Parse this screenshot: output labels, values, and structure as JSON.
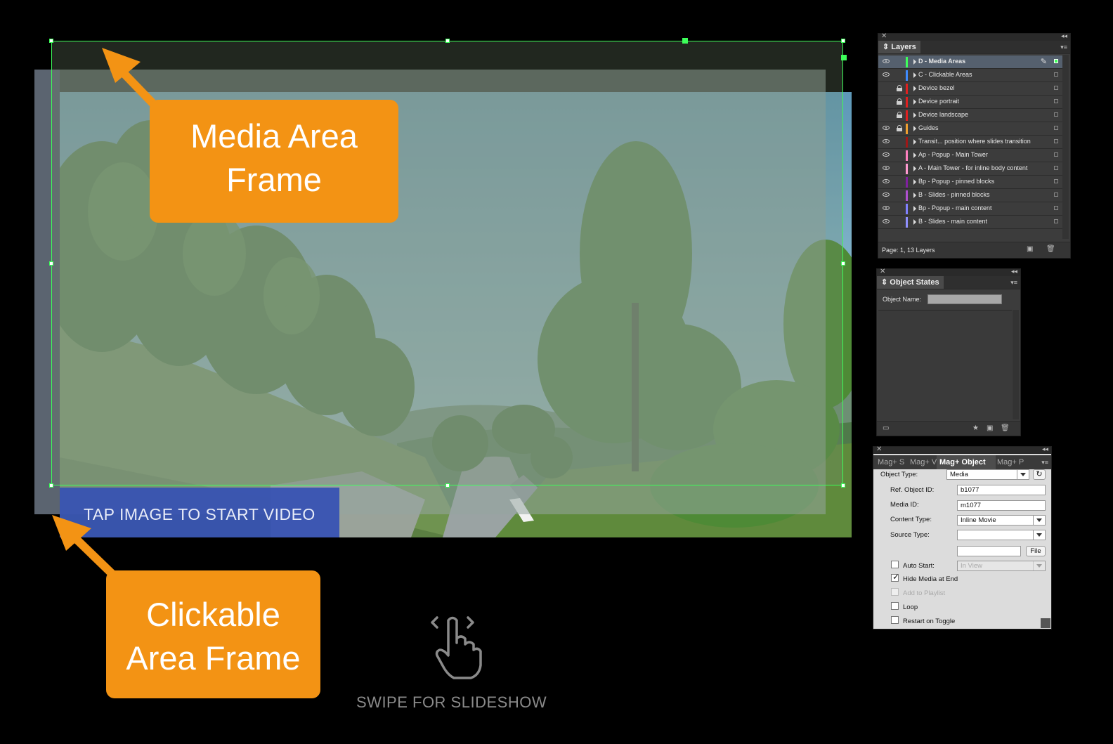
{
  "overlay": {
    "tap_text": "TAP IMAGE TO START VIDEO",
    "swipe_text": "SWIPE FOR SLIDESHOW"
  },
  "callouts": {
    "media_area": [
      "Media Area",
      "Frame"
    ],
    "clickable_area": [
      "Clickable",
      "Area Frame"
    ],
    "color": "#f39314"
  },
  "layers_panel": {
    "title": "Layers",
    "footer": "Page: 1, 13 Layers",
    "layers": [
      {
        "name": "D - Media Areas",
        "color": "#3dff5a",
        "visible": true,
        "locked": false,
        "selected": true
      },
      {
        "name": "C - Clickable Areas",
        "color": "#3f8cff",
        "visible": true,
        "locked": false,
        "selected": false
      },
      {
        "name": "Device bezel",
        "color": "#e02020",
        "visible": false,
        "locked": true,
        "selected": false
      },
      {
        "name": "Device portrait",
        "color": "#e02020",
        "visible": false,
        "locked": true,
        "selected": false
      },
      {
        "name": "Device landscape",
        "color": "#e02020",
        "visible": false,
        "locked": true,
        "selected": false
      },
      {
        "name": "Guides",
        "color": "#f0a030",
        "visible": true,
        "locked": true,
        "selected": false
      },
      {
        "name": "Transit... position where slides transition",
        "color": "#a01818",
        "visible": true,
        "locked": false,
        "selected": false
      },
      {
        "name": "Ap - Popup - Main Tower",
        "color": "#ff80c0",
        "visible": true,
        "locked": false,
        "selected": false
      },
      {
        "name": "A - Main Tower - for inline body content",
        "color": "#ff9ad0",
        "visible": true,
        "locked": false,
        "selected": false
      },
      {
        "name": "Bp - Popup - pinned blocks",
        "color": "#8020a0",
        "visible": true,
        "locked": false,
        "selected": false
      },
      {
        "name": "B - Slides - pinned blocks",
        "color": "#b050d0",
        "visible": true,
        "locked": false,
        "selected": false
      },
      {
        "name": "Bp - Popup - main content",
        "color": "#8080ff",
        "visible": true,
        "locked": false,
        "selected": false
      },
      {
        "name": "B - Slides - main content",
        "color": "#9090ff",
        "visible": true,
        "locked": false,
        "selected": false
      }
    ]
  },
  "states_panel": {
    "title": "Object States",
    "object_name_label": "Object Name:"
  },
  "magplus_panel": {
    "tabs": [
      "Mag+ S",
      "Mag+ V",
      "Mag+ Object",
      "Mag+ P"
    ],
    "active_tab": "Mag+ Object",
    "object_type_label": "Object Type:",
    "object_type_value": "Media",
    "ref_id_label": "Ref. Object ID:",
    "ref_id_value": "b1077",
    "media_id_label": "Media ID:",
    "media_id_value": "m1077",
    "content_type_label": "Content Type:",
    "content_type_value": "Inline Movie",
    "source_type_label": "Source Type:",
    "source_type_value": "",
    "file_button": "File",
    "auto_start_label": "Auto Start:",
    "auto_start_value": "In View",
    "hide_media_label": "Hide Media at End",
    "add_playlist_label": "Add to Playlist",
    "loop_label": "Loop",
    "restart_label": "Restart on Toggle",
    "auto_start_checked": false,
    "hide_media_checked": true,
    "add_playlist_checked": false,
    "loop_checked": false,
    "restart_checked": false
  }
}
